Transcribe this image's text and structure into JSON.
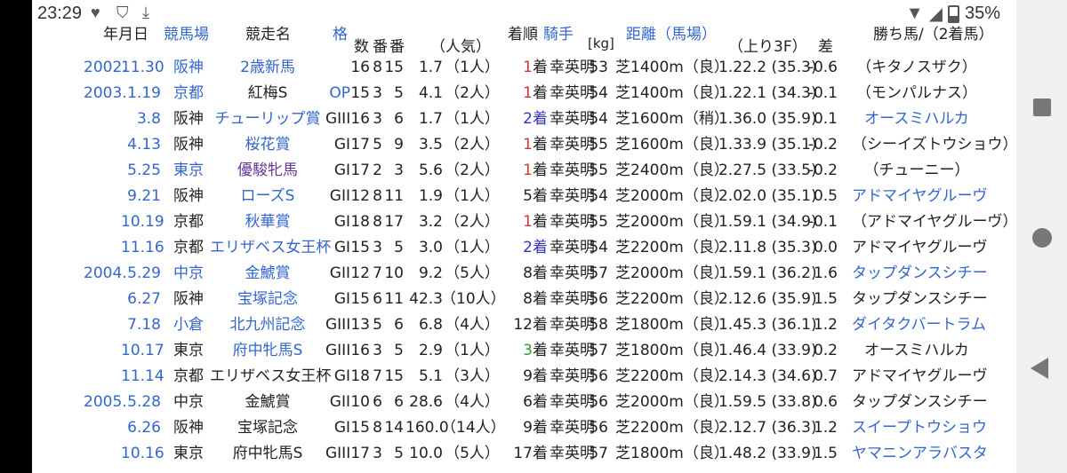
{
  "status_bar": {
    "time": "23:29",
    "icons": [
      "heart-icon",
      "shield-icon",
      "download-done-icon"
    ],
    "battery": "35%"
  },
  "headers": {
    "date": "年月日",
    "venue": "競馬場",
    "race": "競走名",
    "grade": "格",
    "num": "数",
    "bracket": "番",
    "horse_no": "番",
    "odds_pop": "（人気）",
    "placing": "着順",
    "jockey": "騎手",
    "weight": "[kg]",
    "distance": "距離（馬場）",
    "last3f": "（上り3F）",
    "margin": "差",
    "winner": "勝ち馬/（2着馬）"
  },
  "rows": [
    {
      "year": "2002.",
      "md": "11.30",
      "venue": "阪神",
      "race": "2歳新馬",
      "grade": "",
      "num": "16",
      "bracket": "8",
      "horse": "15",
      "odds": "1.7",
      "pop": "（1人）",
      "place_n": "1",
      "place_s": "着",
      "jockey": "幸英明",
      "weight": "53",
      "dist": "芝1400m（良）",
      "time": "1.22.2 (35.3)",
      "diff": "-0.6",
      "winner": "（キタノスザク）"
    },
    {
      "year": "2003.",
      "md": "1.19",
      "venue": "京都",
      "race": "紅梅S",
      "grade": "OP",
      "num": "15",
      "bracket": "3",
      "horse": "5",
      "odds": "4.1",
      "pop": "（2人）",
      "place_n": "1",
      "place_s": "着",
      "jockey": "幸英明",
      "weight": "54",
      "dist": "芝1400m（良）",
      "time": "1.22.1 (34.3)",
      "diff": "-0.1",
      "winner": "（モンパルナス）"
    },
    {
      "year": "",
      "md": "3.8",
      "venue": "阪神",
      "race": "チューリップ賞",
      "grade": "GIII",
      "num": "16",
      "bracket": "3",
      "horse": "6",
      "odds": "1.7",
      "pop": "（1人）",
      "place_n": "2",
      "place_s": "着",
      "jockey": "幸英明",
      "weight": "54",
      "dist": "芝1600m（稍）",
      "time": "1.36.0 (35.9)",
      "diff": "0.1",
      "winner": "オースミハルカ"
    },
    {
      "year": "",
      "md": "4.13",
      "venue": "阪神",
      "race": "桜花賞",
      "grade": "GI",
      "num": "17",
      "bracket": "5",
      "horse": "9",
      "odds": "3.5",
      "pop": "（2人）",
      "place_n": "1",
      "place_s": "着",
      "jockey": "幸英明",
      "weight": "55",
      "dist": "芝1600m（良）",
      "time": "1.33.9 (35.1)",
      "diff": "-0.2",
      "winner": "（シーイズトウショウ）"
    },
    {
      "year": "",
      "md": "5.25",
      "venue": "東京",
      "race": "優駿牝馬",
      "grade": "GI",
      "num": "17",
      "bracket": "2",
      "horse": "3",
      "odds": "5.6",
      "pop": "（2人）",
      "place_n": "1",
      "place_s": "着",
      "jockey": "幸英明",
      "weight": "55",
      "dist": "芝2400m（良）",
      "time": "2.27.5 (33.5)",
      "diff": "-0.2",
      "winner": "（チューニー）"
    },
    {
      "year": "",
      "md": "9.21",
      "venue": "阪神",
      "race": "ローズS",
      "grade": "GII",
      "num": "12",
      "bracket": "8",
      "horse": "11",
      "odds": "1.9",
      "pop": "（1人）",
      "place_n": "5",
      "place_s": "着",
      "jockey": "幸英明",
      "weight": "54",
      "dist": "芝2000m（良）",
      "time": "2.02.0 (35.1)",
      "diff": "0.5",
      "winner": "アドマイヤグルーヴ"
    },
    {
      "year": "",
      "md": "10.19",
      "venue": "京都",
      "race": "秋華賞",
      "grade": "GI",
      "num": "18",
      "bracket": "8",
      "horse": "17",
      "odds": "3.2",
      "pop": "（2人）",
      "place_n": "1",
      "place_s": "着",
      "jockey": "幸英明",
      "weight": "55",
      "dist": "芝2000m（良）",
      "time": "1.59.1 (34.9)",
      "diff": "-0.1",
      "winner": "（アドマイヤグルーヴ）"
    },
    {
      "year": "",
      "md": "11.16",
      "venue": "京都",
      "race": "エリザベス女王杯",
      "grade": "GI",
      "num": "15",
      "bracket": "3",
      "horse": "5",
      "odds": "3.0",
      "pop": "（1人）",
      "place_n": "2",
      "place_s": "着",
      "jockey": "幸英明",
      "weight": "54",
      "dist": "芝2200m（良）",
      "time": "2.11.8 (35.3)",
      "diff": "0.0",
      "winner": "アドマイヤグルーヴ"
    },
    {
      "year": "2004.",
      "md": "5.29",
      "venue": "中京",
      "race": "金鯱賞",
      "grade": "GII",
      "num": "12",
      "bracket": "7",
      "horse": "10",
      "odds": "9.2",
      "pop": "（5人）",
      "place_n": "8",
      "place_s": "着",
      "jockey": "幸英明",
      "weight": "57",
      "dist": "芝2000m（良）",
      "time": "1.59.1 (36.2)",
      "diff": "1.6",
      "winner": "タップダンスシチー"
    },
    {
      "year": "",
      "md": "6.27",
      "venue": "阪神",
      "race": "宝塚記念",
      "grade": "GI",
      "num": "15",
      "bracket": "6",
      "horse": "11",
      "odds": "42.3",
      "pop": "（10人）",
      "place_n": "8",
      "place_s": "着",
      "jockey": "幸英明",
      "weight": "56",
      "dist": "芝2200m（良）",
      "time": "2.12.6 (35.9)",
      "diff": "1.5",
      "winner": "タップダンスシチー"
    },
    {
      "year": "",
      "md": "7.18",
      "venue": "小倉",
      "race": "北九州記念",
      "grade": "GIII",
      "num": "13",
      "bracket": "5",
      "horse": "6",
      "odds": "6.8",
      "pop": "（4人）",
      "place_n": "12",
      "place_s": "着",
      "jockey": "幸英明",
      "weight": "58",
      "dist": "芝1800m（良）",
      "time": "1.45.3 (36.1)",
      "diff": "1.2",
      "winner": "ダイタクバートラム"
    },
    {
      "year": "",
      "md": "10.17",
      "venue": "東京",
      "race": "府中牝馬S",
      "grade": "GIII",
      "num": "16",
      "bracket": "3",
      "horse": "5",
      "odds": "2.9",
      "pop": "（1人）",
      "place_n": "3",
      "place_s": "着",
      "jockey": "幸英明",
      "weight": "57",
      "dist": "芝1800m（良）",
      "time": "1.46.4 (33.9)",
      "diff": "0.2",
      "winner": "オースミハルカ"
    },
    {
      "year": "",
      "md": "11.14",
      "venue": "京都",
      "race": "エリザベス女王杯",
      "grade": "GI",
      "num": "18",
      "bracket": "7",
      "horse": "15",
      "odds": "5.1",
      "pop": "（3人）",
      "place_n": "9",
      "place_s": "着",
      "jockey": "幸英明",
      "weight": "56",
      "dist": "芝2200m（良）",
      "time": "2.14.3 (34.6)",
      "diff": "0.7",
      "winner": "アドマイヤグルーヴ"
    },
    {
      "year": "2005.",
      "md": "5.28",
      "venue": "中京",
      "race": "金鯱賞",
      "grade": "GII",
      "num": "10",
      "bracket": "6",
      "horse": "6",
      "odds": "28.6",
      "pop": "（4人）",
      "place_n": "6",
      "place_s": "着",
      "jockey": "幸英明",
      "weight": "56",
      "dist": "芝2000m（良）",
      "time": "1.59.5 (33.8)",
      "diff": "0.6",
      "winner": "タップダンスシチー"
    },
    {
      "year": "",
      "md": "6.26",
      "venue": "阪神",
      "race": "宝塚記念",
      "grade": "GI",
      "num": "15",
      "bracket": "8",
      "horse": "14",
      "odds": "160.0",
      "pop": "（14人）",
      "place_n": "9",
      "place_s": "着",
      "jockey": "幸英明",
      "weight": "56",
      "dist": "芝2200m（良）",
      "time": "2.12.7 (36.3)",
      "diff": "1.2",
      "winner": "スイープトウショウ"
    },
    {
      "year": "",
      "md": "10.16",
      "venue": "東京",
      "race": "府中牝馬S",
      "grade": "GIII",
      "num": "17",
      "bracket": "3",
      "horse": "5",
      "odds": "10.0",
      "pop": "（5人）",
      "place_n": "17",
      "place_s": "着",
      "jockey": "幸英明",
      "weight": "57",
      "dist": "芝1800m（良）",
      "time": "1.48.2 (33.9)",
      "diff": "1.5",
      "winner": "ヤマニンアラバスタ"
    }
  ]
}
